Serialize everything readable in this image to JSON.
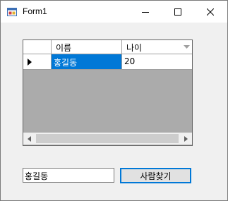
{
  "window": {
    "title": "Form1"
  },
  "grid": {
    "columns": [
      "이름",
      "나이"
    ],
    "rows": [
      {
        "name": "홍길동",
        "age": "20",
        "selected_column": "name",
        "current": true
      }
    ]
  },
  "search": {
    "value": "홍길동",
    "button_label": "사람찾기"
  },
  "colors": {
    "selection": "#0078d7",
    "grid_background": "#ababab",
    "form_background": "#f0f0f0",
    "button_focus_border": "#0078d7"
  },
  "icons": {
    "app": "form-app-icon",
    "minimize": "minimize-icon",
    "maximize": "maximize-icon",
    "close": "close-icon",
    "current_row": "row-pointer-icon",
    "sort": "sort-dropdown-icon",
    "scroll_left": "scroll-left-icon",
    "scroll_right": "scroll-right-icon"
  }
}
